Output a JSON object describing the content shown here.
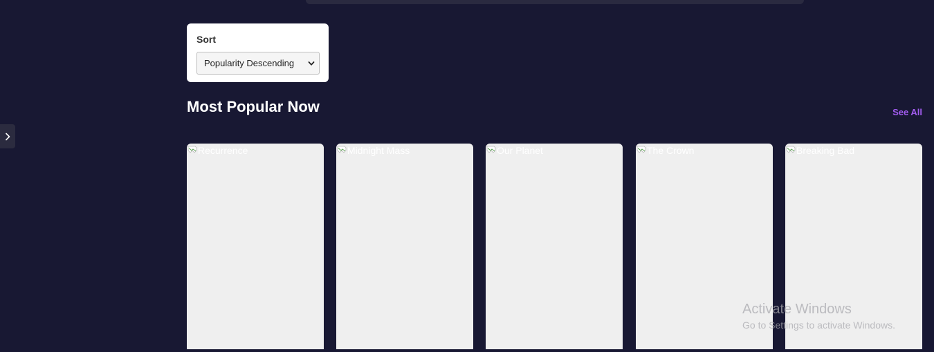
{
  "sort": {
    "label": "Sort",
    "selected": "Popularity Descending"
  },
  "section": {
    "title": "Most Popular Now",
    "see_all_label": "See All"
  },
  "cards": [
    {
      "alt": "Recurrence"
    },
    {
      "alt": "Midnight Mass"
    },
    {
      "alt": "Our Planet"
    },
    {
      "alt": "The Crown"
    },
    {
      "alt": "Breaking Bad"
    }
  ],
  "watermark": {
    "title": "Activate Windows",
    "subtitle": "Go to Settings to activate Windows."
  },
  "colors": {
    "background": "#181833",
    "accent": "#a25cf0",
    "card": "#efefef"
  },
  "icons": {
    "sidebar_toggle": "chevron-right-icon",
    "select_arrow": "chevron-down-icon",
    "broken_image": "broken-image-icon"
  }
}
